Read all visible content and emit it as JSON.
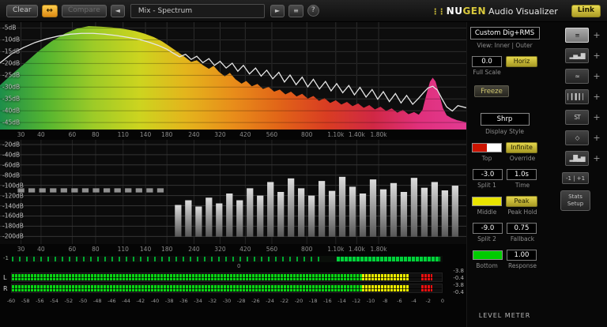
{
  "toolbar": {
    "clear": "Clear",
    "swap_icon": "↔",
    "compare": "Compare",
    "prev_icon": "◄",
    "preset": "Mix - Spectrum",
    "play_icon": "►",
    "menu_icon": "≡",
    "help": "?",
    "brand_dots": "⋮⋮",
    "brand_nu": "NU",
    "brand_gen": "GEN",
    "brand_rest": "Audio Visualizer",
    "link": "Link"
  },
  "accent_color": "#d9c93c",
  "spectrum": {
    "db_labels": [
      "-5dB",
      "-10dB",
      "-15dB",
      "-20dB",
      "-25dB",
      "-30dB",
      "-35dB",
      "-40dB",
      "-45dB"
    ],
    "gradient": [
      "#1e8f4a",
      "#55b530",
      "#9dcb27",
      "#cdd41f",
      "#e4b41c",
      "#e88d1a",
      "#e16418",
      "#d93d22",
      "#d02844",
      "#e0307c",
      "#e23a92"
    ],
    "fill": [
      [
        0,
        235
      ],
      [
        25,
        195
      ],
      [
        50,
        158
      ],
      [
        80,
        112
      ],
      [
        110,
        72
      ],
      [
        140,
        42
      ],
      [
        165,
        24
      ],
      [
        190,
        15
      ],
      [
        215,
        17
      ],
      [
        240,
        20
      ],
      [
        265,
        25
      ],
      [
        290,
        33
      ],
      [
        310,
        43
      ],
      [
        330,
        56
      ],
      [
        348,
        72
      ],
      [
        365,
        92
      ],
      [
        382,
        112
      ],
      [
        398,
        132
      ],
      [
        410,
        148
      ],
      [
        422,
        142
      ],
      [
        435,
        160
      ],
      [
        448,
        174
      ],
      [
        458,
        163
      ],
      [
        470,
        186
      ],
      [
        482,
        202
      ],
      [
        493,
        189
      ],
      [
        505,
        213
      ],
      [
        518,
        229
      ],
      [
        528,
        219
      ],
      [
        540,
        239
      ],
      [
        552,
        230
      ],
      [
        564,
        249
      ],
      [
        576,
        241
      ],
      [
        588,
        259
      ],
      [
        600,
        251
      ],
      [
        612,
        269
      ],
      [
        624,
        259
      ],
      [
        636,
        277
      ],
      [
        648,
        267
      ],
      [
        660,
        285
      ],
      [
        672,
        275
      ],
      [
        684,
        293
      ],
      [
        696,
        283
      ],
      [
        708,
        301
      ],
      [
        720,
        291
      ],
      [
        732,
        307
      ],
      [
        744,
        297
      ],
      [
        756,
        313
      ],
      [
        768,
        303
      ],
      [
        780,
        319
      ],
      [
        792,
        309
      ],
      [
        804,
        325
      ],
      [
        816,
        315
      ],
      [
        828,
        331
      ],
      [
        840,
        321
      ],
      [
        852,
        337
      ],
      [
        864,
        327
      ],
      [
        876,
        343
      ],
      [
        888,
        335
      ],
      [
        898,
        345
      ],
      [
        906,
        327
      ],
      [
        914,
        272
      ],
      [
        922,
        222
      ],
      [
        928,
        207
      ],
      [
        934,
        221
      ],
      [
        942,
        269
      ],
      [
        950,
        321
      ],
      [
        958,
        347
      ],
      [
        968,
        357
      ],
      [
        980,
        365
      ],
      [
        1000,
        373
      ]
    ],
    "line": [
      [
        0,
        152
      ],
      [
        25,
        118
      ],
      [
        50,
        95
      ],
      [
        75,
        76
      ],
      [
        100,
        62
      ],
      [
        125,
        52
      ],
      [
        150,
        45
      ],
      [
        175,
        42
      ],
      [
        200,
        42
      ],
      [
        225,
        45
      ],
      [
        250,
        50
      ],
      [
        275,
        57
      ],
      [
        300,
        65
      ],
      [
        320,
        75
      ],
      [
        340,
        87
      ],
      [
        358,
        101
      ],
      [
        372,
        116
      ],
      [
        385,
        129
      ],
      [
        398,
        120
      ],
      [
        410,
        139
      ],
      [
        422,
        127
      ],
      [
        435,
        151
      ],
      [
        448,
        136
      ],
      [
        460,
        161
      ],
      [
        472,
        146
      ],
      [
        485,
        171
      ],
      [
        498,
        153
      ],
      [
        510,
        183
      ],
      [
        522,
        161
      ],
      [
        535,
        193
      ],
      [
        548,
        171
      ],
      [
        560,
        201
      ],
      [
        572,
        179
      ],
      [
        585,
        211
      ],
      [
        598,
        187
      ],
      [
        610,
        223
      ],
      [
        622,
        197
      ],
      [
        635,
        233
      ],
      [
        648,
        205
      ],
      [
        660,
        241
      ],
      [
        672,
        213
      ],
      [
        685,
        249
      ],
      [
        698,
        221
      ],
      [
        710,
        256
      ],
      [
        722,
        229
      ],
      [
        735,
        263
      ],
      [
        748,
        236
      ],
      [
        760,
        271
      ],
      [
        772,
        243
      ],
      [
        785,
        279
      ],
      [
        798,
        251
      ],
      [
        810,
        287
      ],
      [
        822,
        259
      ],
      [
        835,
        296
      ],
      [
        848,
        266
      ],
      [
        860,
        301
      ],
      [
        872,
        273
      ],
      [
        885,
        306
      ],
      [
        898,
        283
      ],
      [
        908,
        263
      ],
      [
        918,
        245
      ],
      [
        928,
        239
      ],
      [
        938,
        253
      ],
      [
        948,
        286
      ],
      [
        958,
        316
      ],
      [
        970,
        331
      ],
      [
        982,
        311
      ],
      [
        1000,
        319
      ]
    ]
  },
  "freq_labels": [
    {
      "t": "30",
      "p": 4.5
    },
    {
      "t": "40",
      "p": 8.8
    },
    {
      "t": "60",
      "p": 15.5
    },
    {
      "t": "80",
      "p": 20.5
    },
    {
      "t": "110",
      "p": 26.4
    },
    {
      "t": "140",
      "p": 31.2
    },
    {
      "t": "180",
      "p": 35.8
    },
    {
      "t": "240",
      "p": 41.6
    },
    {
      "t": "320",
      "p": 47.2
    },
    {
      "t": "420",
      "p": 52.6
    },
    {
      "t": "560",
      "p": 58.3
    },
    {
      "t": "800",
      "p": 65.8
    },
    {
      "t": "1.10k",
      "p": 72.0
    },
    {
      "t": "1.40k",
      "p": 76.5
    },
    {
      "t": "1.80k",
      "p": 81.2
    }
  ],
  "histogram": {
    "db_labels": [
      "-20dB",
      "-40dB",
      "-60dB",
      "-80dB",
      "-100dB",
      "-120dB",
      "-140dB",
      "-160dB",
      "-180dB",
      "-200dB"
    ],
    "bars": [
      [
        45,
        186,
        202
      ],
      [
        68,
        186,
        202
      ],
      [
        91,
        186,
        202
      ],
      [
        114,
        186,
        202
      ],
      [
        137,
        186,
        202
      ],
      [
        160,
        186,
        202
      ],
      [
        183,
        186,
        202
      ],
      [
        206,
        186,
        202
      ],
      [
        229,
        186,
        202
      ],
      [
        252,
        186,
        202
      ],
      [
        275,
        186,
        202
      ],
      [
        298,
        186,
        202
      ],
      [
        321,
        186,
        202
      ],
      [
        344,
        186,
        202
      ],
      [
        382,
        250,
        372
      ],
      [
        404,
        232,
        372
      ],
      [
        426,
        256,
        372
      ],
      [
        448,
        222,
        372
      ],
      [
        470,
        244,
        372
      ],
      [
        492,
        206,
        372
      ],
      [
        514,
        232,
        372
      ],
      [
        536,
        186,
        372
      ],
      [
        558,
        214,
        372
      ],
      [
        580,
        162,
        372
      ],
      [
        602,
        200,
        372
      ],
      [
        624,
        148,
        372
      ],
      [
        646,
        186,
        372
      ],
      [
        668,
        214,
        372
      ],
      [
        690,
        158,
        372
      ],
      [
        712,
        196,
        372
      ],
      [
        734,
        142,
        372
      ],
      [
        756,
        180,
        372
      ],
      [
        778,
        206,
        372
      ],
      [
        800,
        152,
        372
      ],
      [
        822,
        190,
        372
      ],
      [
        844,
        166,
        372
      ],
      [
        866,
        200,
        372
      ],
      [
        888,
        146,
        372
      ],
      [
        910,
        184,
        372
      ],
      [
        932,
        162,
        372
      ],
      [
        954,
        194,
        372
      ],
      [
        976,
        176,
        372
      ]
    ]
  },
  "meter": {
    "corr_min_label": "-1",
    "corr_zero_label": "0",
    "channels": [
      "L",
      "R"
    ],
    "values": [
      "-3.8",
      "-0.4",
      "-3.8",
      "-0.4"
    ],
    "scale": [
      "-60",
      "-58",
      "-56",
      "-54",
      "-52",
      "-50",
      "-48",
      "-46",
      "-44",
      "-42",
      "-40",
      "-38",
      "-36",
      "-34",
      "-32",
      "-30",
      "-28",
      "-26",
      "-24",
      "-22",
      "-20",
      "-18",
      "-16",
      "-14",
      "-12",
      "-10",
      "-8",
      "-6",
      "-4",
      "-2",
      "0"
    ],
    "green_frac": 0.815,
    "yellow_frac": 0.925,
    "red_start": 0.952,
    "red_end": 0.978,
    "corr_ticks_end": 0.72,
    "corr_solid_start": 0.755,
    "corr_solid_end": 0.995
  },
  "controls": {
    "preset_value": "Custom Dig+RMS",
    "view_label": "View: Inner | Outer",
    "scale_value": "0.0",
    "horiz_button": "Horiz",
    "full_scale_label": "Full Scale",
    "freeze_button": "Freeze",
    "display_style_value": "Shrp",
    "display_style_label": "Display Style",
    "infinite_button": "Infinite",
    "top_label": "Top",
    "override_label": "Override",
    "split1_value": "-3.0",
    "time_value": "1.0s",
    "split1_label": "Split 1",
    "time_label": "Time",
    "peak_button": "Peak",
    "middle_label": "Middle",
    "peak_hold_label": "Peak Hold",
    "split2_value": "-9.0",
    "fallback_value": "0.75",
    "split2_label": "Split 2",
    "fallback_label": "Fallback",
    "response_value": "1.00",
    "bottom_label": "Bottom",
    "response_label": "Response",
    "level_meter_label": "LEVEL METER",
    "top_swatch_colors": [
      "#cc1400",
      "#ffffff"
    ],
    "middle_swatch_color": "#e8e400",
    "bottom_swatch_color": "#00cc00"
  },
  "modes": {
    "items": [
      {
        "name": "combined-view",
        "glyph": "≡",
        "selected": true
      },
      {
        "name": "histogram-view",
        "glyph": "▂▅▃▇",
        "selected": false
      },
      {
        "name": "waveform-view",
        "glyph": "≈",
        "selected": false
      },
      {
        "name": "spectrogram-view",
        "glyph": "▏▎▍▎▏",
        "selected": false
      },
      {
        "name": "stereo-view",
        "glyph": "ST",
        "selected": false
      },
      {
        "name": "vectorscope-view",
        "glyph": "◇",
        "selected": false
      },
      {
        "name": "meter-view",
        "glyph": "▂█▄▆",
        "selected": false
      }
    ],
    "plus": "+",
    "range_button": "-1 | +1",
    "stats_button": "Stats Setup"
  }
}
